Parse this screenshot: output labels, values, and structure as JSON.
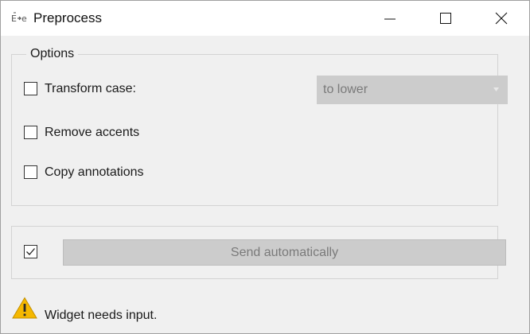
{
  "window": {
    "title": "Preprocess",
    "app_icon": "preprocess-text-icon",
    "controls": [
      "minimize-icon",
      "maximize-icon",
      "close-icon"
    ]
  },
  "options": {
    "group_title": "Options",
    "transform_case": {
      "label": "Transform case:",
      "checked": false
    },
    "case_select": {
      "value": "to lower",
      "enabled": false
    },
    "remove_accents": {
      "label": "Remove accents",
      "checked": false
    },
    "copy_annotations": {
      "label": "Copy annotations",
      "checked": false
    }
  },
  "commit": {
    "auto_checked": true,
    "send_label": "Send automatically",
    "send_enabled": false
  },
  "status": {
    "icon": "warning-icon",
    "message": "Widget needs input."
  },
  "colors": {
    "warning": "#f5b800",
    "disabled_bg": "#cccccc",
    "disabled_text": "#7a7a7a"
  }
}
